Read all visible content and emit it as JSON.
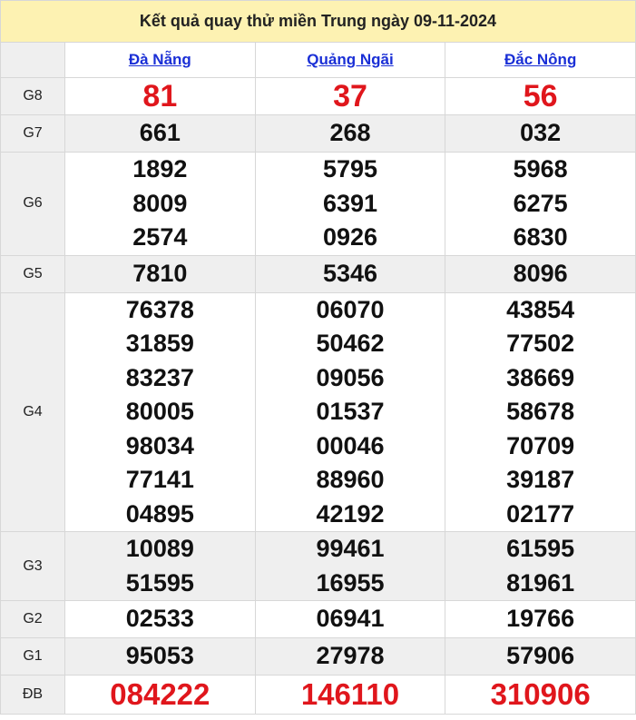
{
  "title": "Kết quả quay thử miền Trung ngày 09-11-2024",
  "provinces": [
    "Đà Nẵng",
    "Quảng Ngãi",
    "Đắc Nông"
  ],
  "prizes": [
    {
      "label": "G8",
      "values": [
        [
          "81"
        ],
        [
          "37"
        ],
        [
          "56"
        ]
      ]
    },
    {
      "label": "G7",
      "values": [
        [
          "661"
        ],
        [
          "268"
        ],
        [
          "032"
        ]
      ]
    },
    {
      "label": "G6",
      "values": [
        [
          "1892",
          "8009",
          "2574"
        ],
        [
          "5795",
          "6391",
          "0926"
        ],
        [
          "5968",
          "6275",
          "6830"
        ]
      ]
    },
    {
      "label": "G5",
      "values": [
        [
          "7810"
        ],
        [
          "5346"
        ],
        [
          "8096"
        ]
      ]
    },
    {
      "label": "G4",
      "values": [
        [
          "76378",
          "31859",
          "83237",
          "80005",
          "98034",
          "77141",
          "04895"
        ],
        [
          "06070",
          "50462",
          "09056",
          "01537",
          "00046",
          "88960",
          "42192"
        ],
        [
          "43854",
          "77502",
          "38669",
          "58678",
          "70709",
          "39187",
          "02177"
        ]
      ]
    },
    {
      "label": "G3",
      "values": [
        [
          "10089",
          "51595"
        ],
        [
          "99461",
          "16955"
        ],
        [
          "61595",
          "81961"
        ]
      ]
    },
    {
      "label": "G2",
      "values": [
        [
          "02533"
        ],
        [
          "06941"
        ],
        [
          "19766"
        ]
      ]
    },
    {
      "label": "G1",
      "values": [
        [
          "95053"
        ],
        [
          "27978"
        ],
        [
          "57906"
        ]
      ]
    },
    {
      "label": "ĐB",
      "values": [
        [
          "084222"
        ],
        [
          "146110"
        ],
        [
          "310906"
        ]
      ]
    }
  ],
  "colors": {
    "highlight": "#e0161c",
    "link": "#1a2fd6",
    "title_bg": "#fdf2b2",
    "alt_bg": "#efefef"
  }
}
